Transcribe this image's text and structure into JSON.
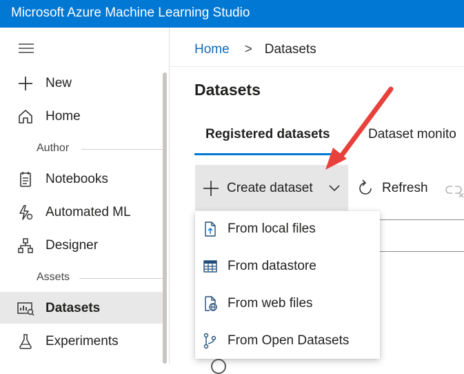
{
  "app": {
    "title": "Microsoft Azure Machine Learning Studio"
  },
  "sidebar": {
    "items": [
      {
        "label": "New",
        "icon": "plus-icon"
      },
      {
        "label": "Home",
        "icon": "home-icon"
      },
      {
        "label": "Notebooks",
        "icon": "notebook-icon"
      },
      {
        "label": "Automated ML",
        "icon": "automated-ml-icon"
      },
      {
        "label": "Designer",
        "icon": "designer-icon"
      },
      {
        "label": "Datasets",
        "icon": "datasets-icon",
        "selected": true
      },
      {
        "label": "Experiments",
        "icon": "experiments-icon"
      }
    ],
    "sections": {
      "author": "Author",
      "assets": "Assets"
    }
  },
  "breadcrumb": {
    "home": "Home",
    "separator": ">",
    "current": "Datasets"
  },
  "page": {
    "title": "Datasets"
  },
  "tabs": [
    {
      "label": "Registered datasets",
      "active": true
    },
    {
      "label": "Dataset monito",
      "active": false
    }
  ],
  "toolbar": {
    "create_label": "Create dataset",
    "refresh_label": "Refresh"
  },
  "dropdown": {
    "items": [
      {
        "label": "From local files",
        "icon": "local-file-icon"
      },
      {
        "label": "From datastore",
        "icon": "datastore-table-icon"
      },
      {
        "label": "From web files",
        "icon": "web-file-icon"
      },
      {
        "label": "From Open Datasets",
        "icon": "open-datasets-icon"
      }
    ]
  },
  "colors": {
    "accent": "#0078d4",
    "annotation_arrow": "#e8413c",
    "selected_bg": "#e8e8e8"
  }
}
